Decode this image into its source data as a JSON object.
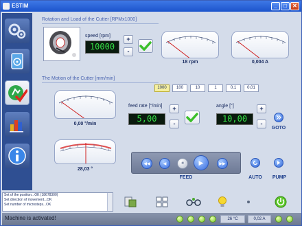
{
  "window": {
    "title": "ESTIM",
    "controls": {
      "minimize": "_",
      "maximize": "□",
      "close": "✕"
    }
  },
  "sidebar": {
    "items": [
      {
        "name": "settings",
        "icon": "gears-icon"
      },
      {
        "name": "device",
        "icon": "device-icon"
      },
      {
        "name": "motion",
        "icon": "motion-check-icon",
        "active": true
      },
      {
        "name": "statistics",
        "icon": "chart-icon"
      },
      {
        "name": "info",
        "icon": "info-icon"
      }
    ]
  },
  "rotation": {
    "header": "Rotation and Load of the Cutter [RPMx1000]",
    "speed_label": "speed [rpm]",
    "speed_value": "10000",
    "plus": "+",
    "minus": "-",
    "rpm_gauge": {
      "value_label": "18 rpm",
      "level": 0.0
    },
    "current_gauge": {
      "value_label": "0,004 A",
      "level": 0.0
    }
  },
  "motion": {
    "header": "The Motion of the Cutter [mm/min]",
    "increments": [
      "1000",
      "100",
      "10",
      "1",
      "0,1",
      "0,01"
    ],
    "selected_increment": "1000",
    "feed_gauge": {
      "value_label": "0,00 °/min",
      "level": 0.0
    },
    "angle_gauge": {
      "value_label": "28,03 °",
      "level": 0.5
    },
    "feed_rate_label": "feed rate [°/min]",
    "feed_rate_value": "5,00",
    "angle_label": "angle [°]",
    "angle_value": "10,00",
    "plus": "+",
    "minus": "-",
    "goto_label": "GOTO",
    "feed_label": "FEED",
    "auto_label": "AUTO",
    "pump_label": "PUMP"
  },
  "log": {
    "lines": [
      "Set of the position...OK   (18678300)",
      "Set direction of movement...OK",
      "Set number of microsteps...OK"
    ]
  },
  "status": {
    "message": "Machine is activated!",
    "temperature": "26 °C",
    "current": "0,02 A"
  },
  "colors": {
    "accent": "#1c54cc",
    "panel": "#d4dcea",
    "lcd_bg": "#0a1a0e",
    "lcd_text": "#35e046",
    "needle": "#d02020",
    "selected": "#f6f0a0"
  }
}
